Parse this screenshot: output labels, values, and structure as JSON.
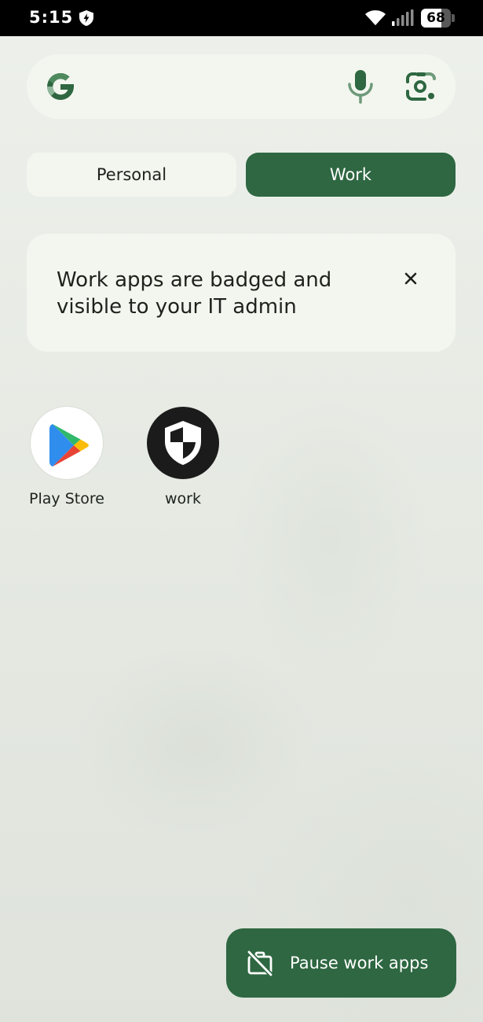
{
  "status_bar": {
    "time": "5:15",
    "battery_level": "68",
    "icons": [
      "shield-bolt-icon",
      "wifi-icon",
      "cell-signal-icon",
      "battery-icon"
    ]
  },
  "search": {
    "logo": "google-g-logo",
    "mic_icon": "microphone-icon",
    "lens_icon": "google-lens-icon"
  },
  "tabs": [
    {
      "label": "Personal",
      "selected": false
    },
    {
      "label": "Work",
      "selected": true
    }
  ],
  "info_card": {
    "text": "Work apps are badged and visible to your IT admin",
    "close_icon": "close-icon"
  },
  "apps": [
    {
      "label": "Play Store",
      "icon": "play-store-icon"
    },
    {
      "label": "work",
      "icon": "work-shield-icon"
    }
  ],
  "pause_button": {
    "label": "Pause work apps",
    "icon": "work-off-icon"
  },
  "colors": {
    "accent": "#2e6741",
    "surface": "#f3f6ef",
    "background": "#e6e9e3",
    "text": "#1d231c"
  }
}
